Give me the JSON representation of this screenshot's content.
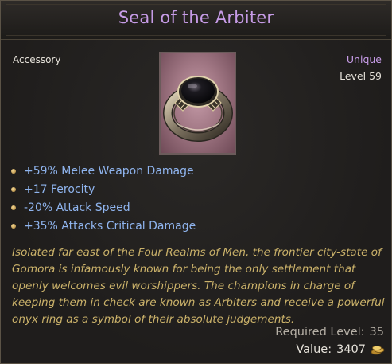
{
  "item": {
    "name": "Seal of the Arbiter",
    "category": "Accessory",
    "rarity": "Unique",
    "level": "Level 59",
    "icon": "onyx-ring-icon"
  },
  "stats": [
    "+59% Melee Weapon Damage",
    "+17 Ferocity",
    "-20% Attack Speed",
    "+35% Attacks Critical Damage"
  ],
  "lore": [
    "Isolated far east of the Four Realms of Men, the frontier city-state of",
    "Gomora is infamously known for being the only settlement that",
    "openly welcomes evil worshippers. The champions in charge of",
    "keeping them in check are known as Arbiters and receive a powerful",
    "onyx ring as a symbol of their absolute judgements."
  ],
  "requirement": {
    "label": "Required Level:",
    "value": "35"
  },
  "value": {
    "label": "Value:",
    "amount": "3407",
    "icon": "gold-coins-icon"
  },
  "colors": {
    "title": "#c69be6",
    "stat_text": "#8fb4ee",
    "lore_text": "#cbb26a",
    "portrait_bg": "#a17784"
  }
}
